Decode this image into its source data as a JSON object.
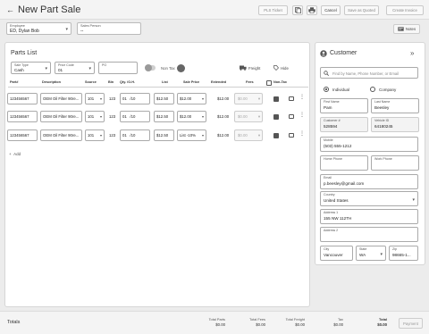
{
  "header": {
    "title": "New Part Sale",
    "buttons": {
      "pls_ticket": "PLS Ticket",
      "cancel": "Cancel",
      "save_as_quoted": "Save as Quoted",
      "create_invoice": "Create Invoice"
    },
    "icons": [
      "back-arrow-icon",
      "copy-icon",
      "print-icon"
    ]
  },
  "employee": {
    "label": "Employee",
    "value": "ED, Dylan Bob"
  },
  "sales_person": {
    "label": "Sales Person",
    "value": "--"
  },
  "notes_button": "Notes",
  "parts_list": {
    "title": "Parts List",
    "sale_type": {
      "label": "Sale Type",
      "value": "Cash"
    },
    "price_code": {
      "label": "Price Code",
      "value": "01"
    },
    "po": {
      "label": "PO",
      "value": ""
    },
    "non_tax_label": "Non Tax",
    "freight_label": "Freight",
    "hide_label": "Hide",
    "columns": [
      "Part#",
      "Description",
      "Source",
      "Bin",
      "Qty. /O.H.",
      "List",
      "Sale Price",
      "Extended",
      "Fees",
      "Non-Tax"
    ],
    "rows": [
      {
        "part": "123456567",
        "description": "OEM Oil Filter 90re...",
        "source": "101",
        "bin": "123",
        "qty": "01",
        "oh": "/10",
        "list": "$12.50",
        "sale_price": "$12.00",
        "extended": "$12.00",
        "fees": "$0.00"
      },
      {
        "part": "123456567",
        "description": "OEM Oil Filter 90re...",
        "source": "101",
        "bin": "123",
        "qty": "01",
        "oh": "/10",
        "list": "$12.50",
        "sale_price": "$12.00",
        "extended": "$12.00",
        "fees": "$0.00"
      },
      {
        "part": "123456567",
        "description": "OEM Oil Filter 90re...",
        "source": "101",
        "bin": "123",
        "qty": "01",
        "oh": "/10",
        "list": "$12.50",
        "sale_price": "List -10%",
        "extended": "$12.00",
        "fees": "$0.00"
      }
    ],
    "add_label": "Add"
  },
  "customer": {
    "title": "Customer",
    "search_placeholder": "Find by Name, Phone Number, or Email",
    "type_options": [
      "Individual",
      "Company"
    ],
    "selected_type": "Individual",
    "first_name": {
      "label": "First Name",
      "value": "Pam"
    },
    "last_name": {
      "label": "Last Name",
      "value": "Beesley"
    },
    "customer_no": {
      "label": "Customer #",
      "value": "528594"
    },
    "vehicle_id": {
      "label": "Vehicle ID",
      "value": "64180245"
    },
    "mobile": {
      "label": "Mobile",
      "value": "(503) 555-1212"
    },
    "home_phone": {
      "label": "Home Phone",
      "value": ""
    },
    "work_phone": {
      "label": "Work Phone",
      "value": ""
    },
    "email": {
      "label": "Email",
      "value": "p.beesley@gmail.com"
    },
    "country": {
      "label": "Country",
      "value": "United States"
    },
    "address1": {
      "label": "Address 1",
      "value": "155 NW 112TH"
    },
    "address2": {
      "label": "Address 2",
      "value": ""
    },
    "city": {
      "label": "City",
      "value": "Vancouver"
    },
    "state": {
      "label": "State",
      "value": "WA"
    },
    "zip": {
      "label": "Zip",
      "value": "98665-1..."
    }
  },
  "footer": {
    "title": "Totals",
    "items": [
      {
        "label": "Total Parts",
        "value": "$0.00"
      },
      {
        "label": "Total Fees",
        "value": "$0.00"
      },
      {
        "label": "Total Freight",
        "value": "$0.00"
      },
      {
        "label": "Tax",
        "value": "$0.00"
      },
      {
        "label": "Total",
        "value": "$0.00"
      }
    ],
    "payment_label": "Payment"
  }
}
